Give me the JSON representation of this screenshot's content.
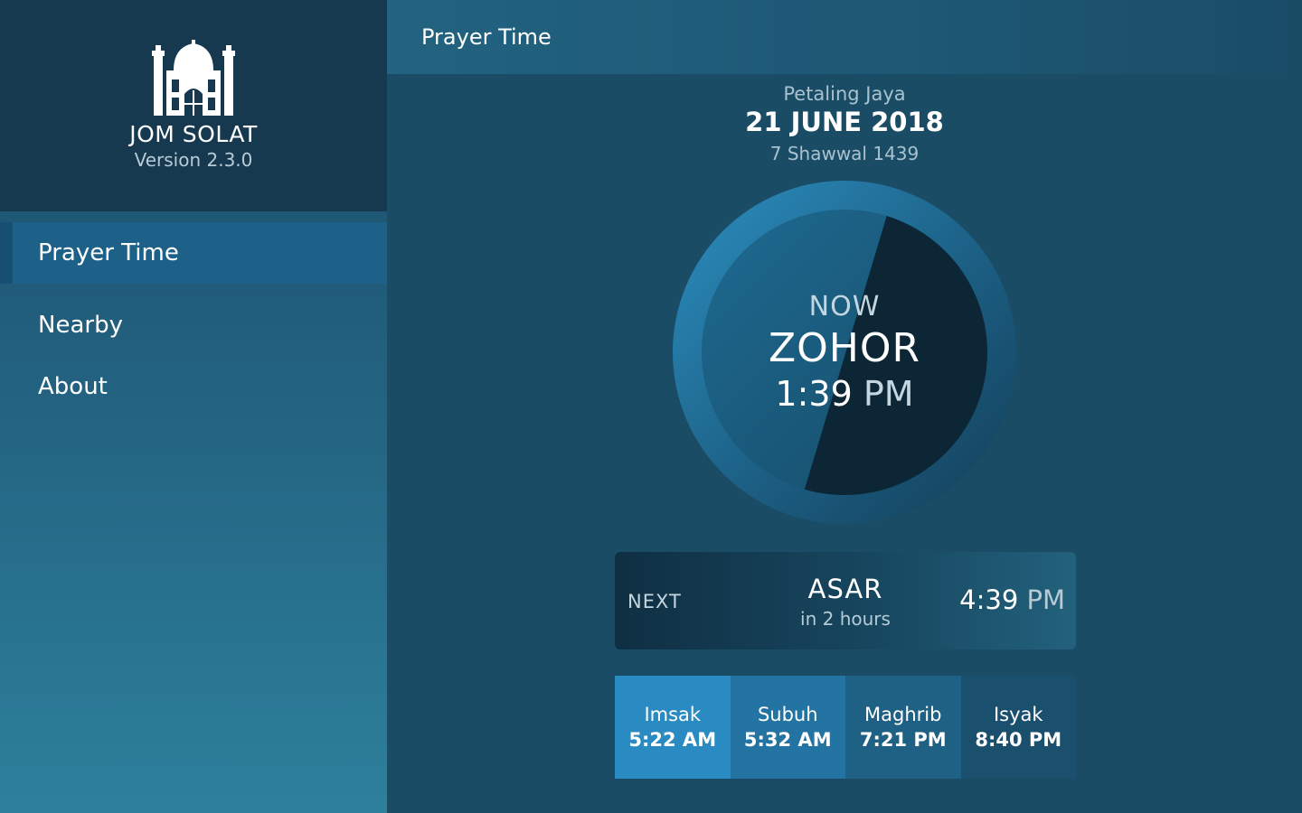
{
  "sidebar": {
    "app_name": "JOM SOLAT",
    "version": "Version 2.3.0",
    "logo_icon": "mosque-icon",
    "items": [
      {
        "label": "Prayer Time",
        "active": true
      },
      {
        "label": "Nearby",
        "active": false
      },
      {
        "label": "About",
        "active": false
      }
    ]
  },
  "topbar": {
    "title": "Prayer Time"
  },
  "date": {
    "location": "Petaling Jaya",
    "gregorian": "21 JUNE 2018",
    "hijri": "7 Shawwal 1439"
  },
  "now": {
    "label": "NOW",
    "prayer": "ZOHOR",
    "time": "1:39",
    "ampm": "PM"
  },
  "next": {
    "label": "NEXT",
    "prayer": "ASAR",
    "eta": "in 2 hours",
    "time": "4:39",
    "ampm": "PM"
  },
  "schedule": [
    {
      "name": "Imsak",
      "time": "5:22 AM"
    },
    {
      "name": "Subuh",
      "time": "5:32 AM"
    },
    {
      "name": "Maghrib",
      "time": "7:21 PM"
    },
    {
      "name": "Isyak",
      "time": "8:40 PM"
    }
  ],
  "colors": {
    "sidebar_header": "#16394f",
    "active_item": "#1d6189",
    "main_bg": "#1a4c66",
    "accent": "#2a8bc2"
  }
}
